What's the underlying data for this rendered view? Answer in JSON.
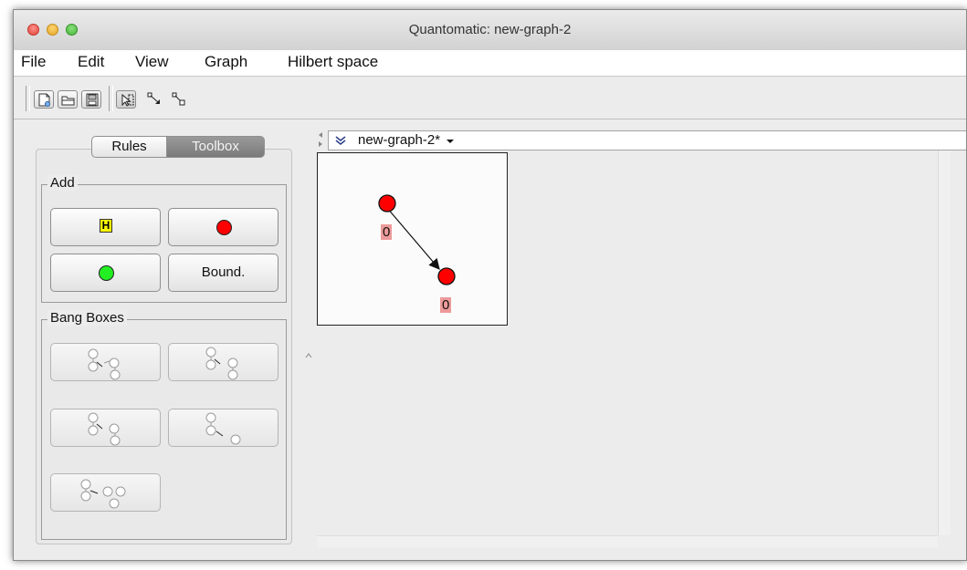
{
  "window": {
    "title": "Quantomatic: new-graph-2"
  },
  "menu": [
    "File",
    "Edit",
    "View",
    "Graph",
    "Hilbert space"
  ],
  "toolbar": {
    "file_buttons": [
      "new-graph-icon",
      "open-folder-icon",
      "save-disk-icon"
    ],
    "tools": [
      "select-tool-icon",
      "add-edge-icon",
      "add-boundary-edge-icon"
    ],
    "selected_tool": "select-tool-icon"
  },
  "left_panel": {
    "tabs": [
      {
        "label": "Rules",
        "active": false
      },
      {
        "label": "Toolbox",
        "active": true
      }
    ],
    "add_group": {
      "title": "Add",
      "h_label": "H",
      "boundary_label": "Bound.",
      "red_color": "#ff0000",
      "green_color": "#22ee22"
    },
    "bang_group": {
      "title": "Bang Boxes"
    }
  },
  "graph": {
    "tab_label": "new-graph-2*",
    "vertices": [
      {
        "label": "0",
        "color": "#ff0000"
      },
      {
        "label": "0",
        "color": "#ff0000"
      }
    ],
    "edge_directed": true
  }
}
